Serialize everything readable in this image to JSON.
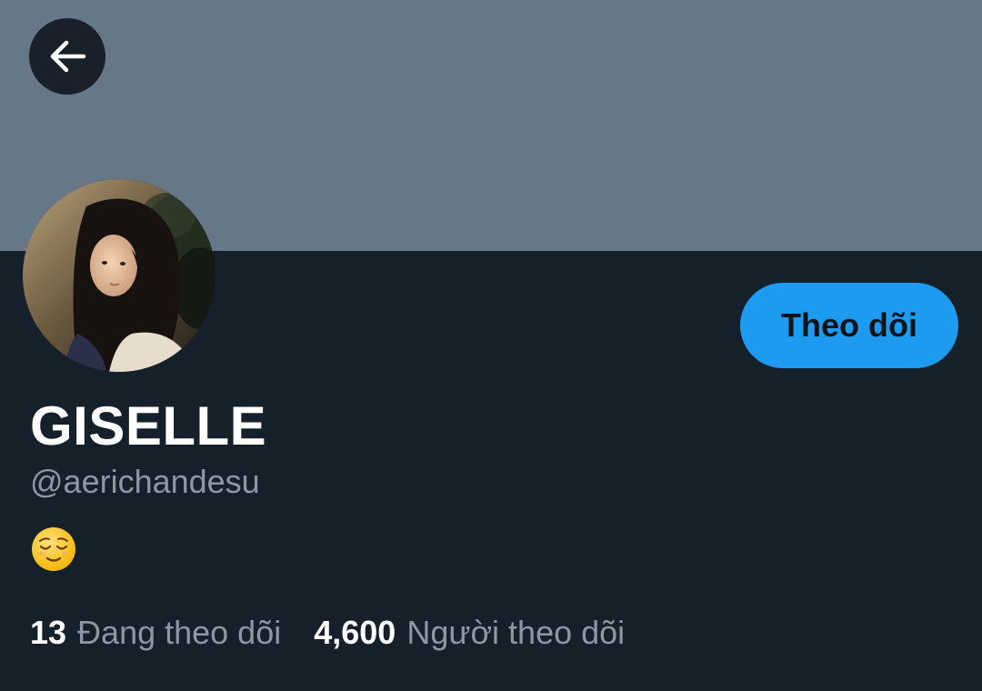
{
  "header": {
    "back_icon": "arrow-left-icon",
    "banner_color": "#667788"
  },
  "profile": {
    "display_name": "GISELLE",
    "handle": "@aerichandesu",
    "bio_emoji": "relieved-face-emoji",
    "follow_label": "Theo dõi",
    "accent": "#1D9BF0"
  },
  "stats": {
    "following_count": "13",
    "following_label": "Đang theo dõi",
    "followers_count": "4,600",
    "followers_label": "Người theo dõi"
  }
}
